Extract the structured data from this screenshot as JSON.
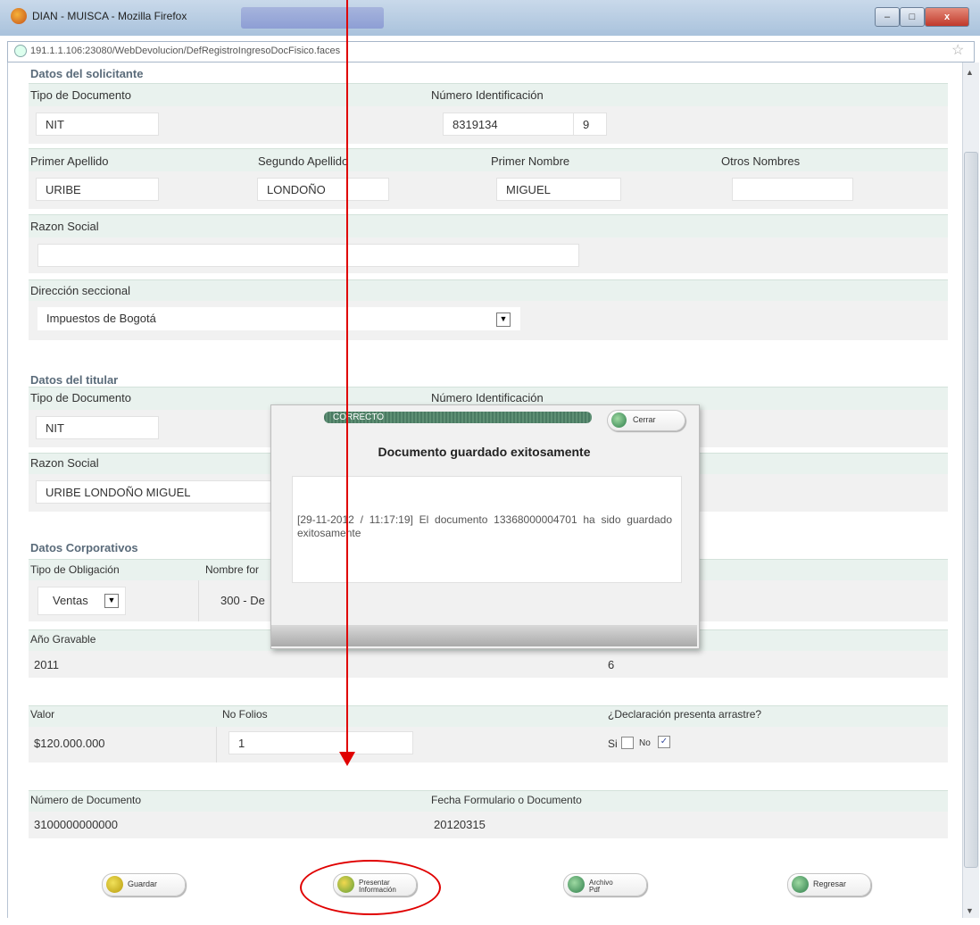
{
  "window": {
    "title": "DIAN - MUISCA - Mozilla Firefox",
    "controls": {
      "minimize": "–",
      "maximize": "□",
      "close": "x"
    },
    "url": "191.1.1.106:23080/WebDevolucion/DefRegistroIngresoDocFisico.faces"
  },
  "solicitante": {
    "section_title": "Datos del solicitante",
    "tipo_documento_label": "Tipo de Documento",
    "tipo_documento_value": "NIT",
    "numero_id_label": "Número Identificación",
    "numero_id_value": "8319134",
    "dv_value": "9",
    "primer_apellido_label": "Primer Apellido",
    "primer_apellido_value": "URIBE",
    "segundo_apellido_label": "Segundo Apellido",
    "segundo_apellido_value": "LONDOÑO",
    "primer_nombre_label": "Primer Nombre",
    "primer_nombre_value": "MIGUEL",
    "otros_nombres_label": "Otros Nombres",
    "otros_nombres_value": "",
    "razon_social_label": "Razon Social",
    "razon_social_value": "",
    "direccion_label": "Dirección seccional",
    "direccion_value": "Impuestos de Bogotá"
  },
  "titular": {
    "section_title": "Datos del titular",
    "tipo_documento_label": "Tipo de Documento",
    "tipo_documento_value": "NIT",
    "numero_id_label": "Número Identificación",
    "razon_social_label": "Razon Social",
    "razon_social_value": "URIBE LONDOÑO MIGUEL"
  },
  "corporativos": {
    "section_title": "Datos Corporativos",
    "tipo_obligacion_label": "Tipo de Obligación",
    "tipo_obligacion_value": "Ventas",
    "nombre_formulario_label": "Nombre for",
    "nombre_formulario_value": "300 - De",
    "anio_gravable_label": "Año Gravable",
    "anio_gravable_value": "2011",
    "periodo_value": "6",
    "valor_label": "Valor",
    "valor_value": "$120.000.000",
    "no_folios_label": "No Folios",
    "no_folios_value": "1",
    "arrastre_label": "¿Declaración presenta arrastre?",
    "si_label": "Si",
    "no_label": "No",
    "no_checked": true,
    "numero_documento_label": "Número de Documento",
    "numero_documento_value": "3100000000000",
    "fecha_label": "Fecha Formulario o Documento",
    "fecha_value": "20120315"
  },
  "buttons": {
    "guardar": "Guardar",
    "presentar": "Presentar Información",
    "archivo_pdf": "Archivo Pdf",
    "regresar": "Regresar"
  },
  "modal": {
    "status": "CORRECTO",
    "close_label": "Cerrar",
    "title": "Documento guardado exitosamente",
    "message": "[29-11-2012 / 11:17:19] El documento 13368000004701 ha sido guardado exitosamente"
  },
  "colors": {
    "band": "#e9f2ee",
    "field_row": "#f1f1f1",
    "section_title": "#5a6b7a",
    "annotation": "#e00000",
    "success_green": "#4a7a62"
  },
  "icons": [
    "firefox-icon",
    "lock-icon",
    "bookmark-star-icon",
    "dropdown-arrow-icon",
    "checkbox-icon",
    "save-icon",
    "present-icon",
    "pdf-icon",
    "back-icon",
    "close-icon"
  ]
}
